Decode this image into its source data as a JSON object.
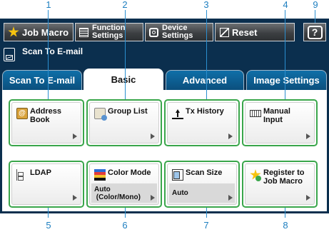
{
  "callouts": {
    "top": [
      "1",
      "2",
      "3",
      "4",
      "9"
    ],
    "bottom": [
      "5",
      "6",
      "7",
      "8"
    ]
  },
  "toolbar": {
    "job_macro_label": "Job Macro",
    "function_settings_label_1": "Function",
    "function_settings_label_2": "Settings",
    "device_settings_label_1": "Device",
    "device_settings_label_2": "Settings",
    "reset_label": "Reset",
    "help_label": "?"
  },
  "screen_title": "Scan To E-mail",
  "tabs": [
    {
      "label": "Scan To E-mail",
      "active": false
    },
    {
      "label": "Basic",
      "active": true
    },
    {
      "label": "Advanced",
      "active": false
    },
    {
      "label": "Image Settings",
      "active": false
    }
  ],
  "cards": {
    "address_book": {
      "line1": "Address",
      "line2": "Book"
    },
    "group_list": {
      "label": "Group List"
    },
    "tx_history": {
      "label": "Tx History"
    },
    "manual_input": {
      "line1": "Manual",
      "line2": "Input"
    },
    "ldap": {
      "label": "LDAP"
    },
    "color_mode": {
      "label": "Color Mode",
      "value1": "Auto",
      "value2": "(Color/Mono)"
    },
    "scan_size": {
      "label": "Scan Size",
      "value": "Auto"
    },
    "register_macro": {
      "line1": "Register to",
      "line2": "Job Macro"
    }
  },
  "colors": {
    "panel_bg": "#0b2f4e",
    "card_border": "#3aa64b",
    "callout": "#1e7fc0"
  }
}
